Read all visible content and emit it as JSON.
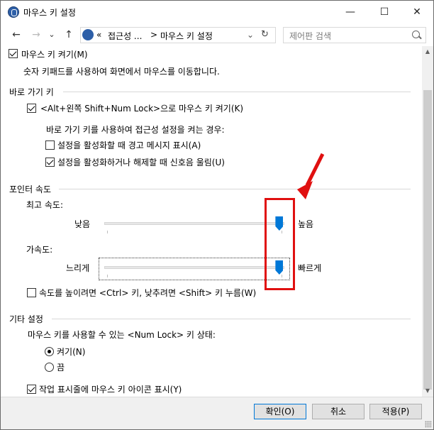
{
  "window": {
    "title": "마우스 키 설정",
    "minimize_glyph": "—",
    "maximize_glyph": "☐",
    "close_glyph": "✕"
  },
  "nav": {
    "back_glyph": "←",
    "forward_glyph": "→",
    "dropdown_glyph": "⌄",
    "up_glyph": "↑",
    "breadcrumb_prefix": "«",
    "breadcrumb_parent": "접근성 ...",
    "breadcrumb_sep": ">",
    "breadcrumb_current": "마우스 키 설정",
    "refresh_glyph": "↻"
  },
  "search": {
    "placeholder": "제어판 검색"
  },
  "main": {
    "turn_on": {
      "label": "마우스 키 켜기(M)",
      "checked": true
    },
    "turn_on_desc": "숫자 키패드를 사용하여 화면에서 마우스를 이동합니다.",
    "shortcut_section": "바로 가기 키",
    "shortcut_toggle": {
      "label": "<Alt+왼쪽 Shift+Num Lock>으로 마우스 키 켜기(K)",
      "checked": true
    },
    "shortcut_desc": "바로 가기 키를 사용하여 접근성 설정을 켜는 경우:",
    "warning_msg": {
      "label": "설정을 활성화할 때 경고 메시지 표시(A)",
      "checked": false
    },
    "sound": {
      "label": "설정을 활성화하거나 해제할 때 신호음 울림(U)",
      "checked": true
    },
    "pointer_section": "포인터 속도",
    "top_speed_label": "최고 속도:",
    "top_speed_low": "낮음",
    "top_speed_high": "높음",
    "top_speed_level": 0.97,
    "accel_label": "가속도:",
    "accel_low": "느리게",
    "accel_high": "빠르게",
    "accel_level": 0.97,
    "ctrl_shift": {
      "label": "속도를 높이려면 <Ctrl> 키, 낮추려면 <Shift> 키 누름(W)",
      "checked": false
    },
    "other_section": "기타 설정",
    "numlock_desc": "마우스 키를 사용할 수 있는 <Num Lock> 키 상태:",
    "on_option": {
      "label": "켜기(N)",
      "selected": true
    },
    "off_option": {
      "label": "끔",
      "selected": false
    },
    "taskbar_icon": {
      "label": "작업 표시줄에 마우스 키 아이콘 표시(Y)",
      "checked": true
    }
  },
  "buttons": {
    "ok": "확인(O)",
    "cancel": "취소",
    "apply": "적용(P)"
  },
  "annotation": {
    "color": "#e01010"
  }
}
